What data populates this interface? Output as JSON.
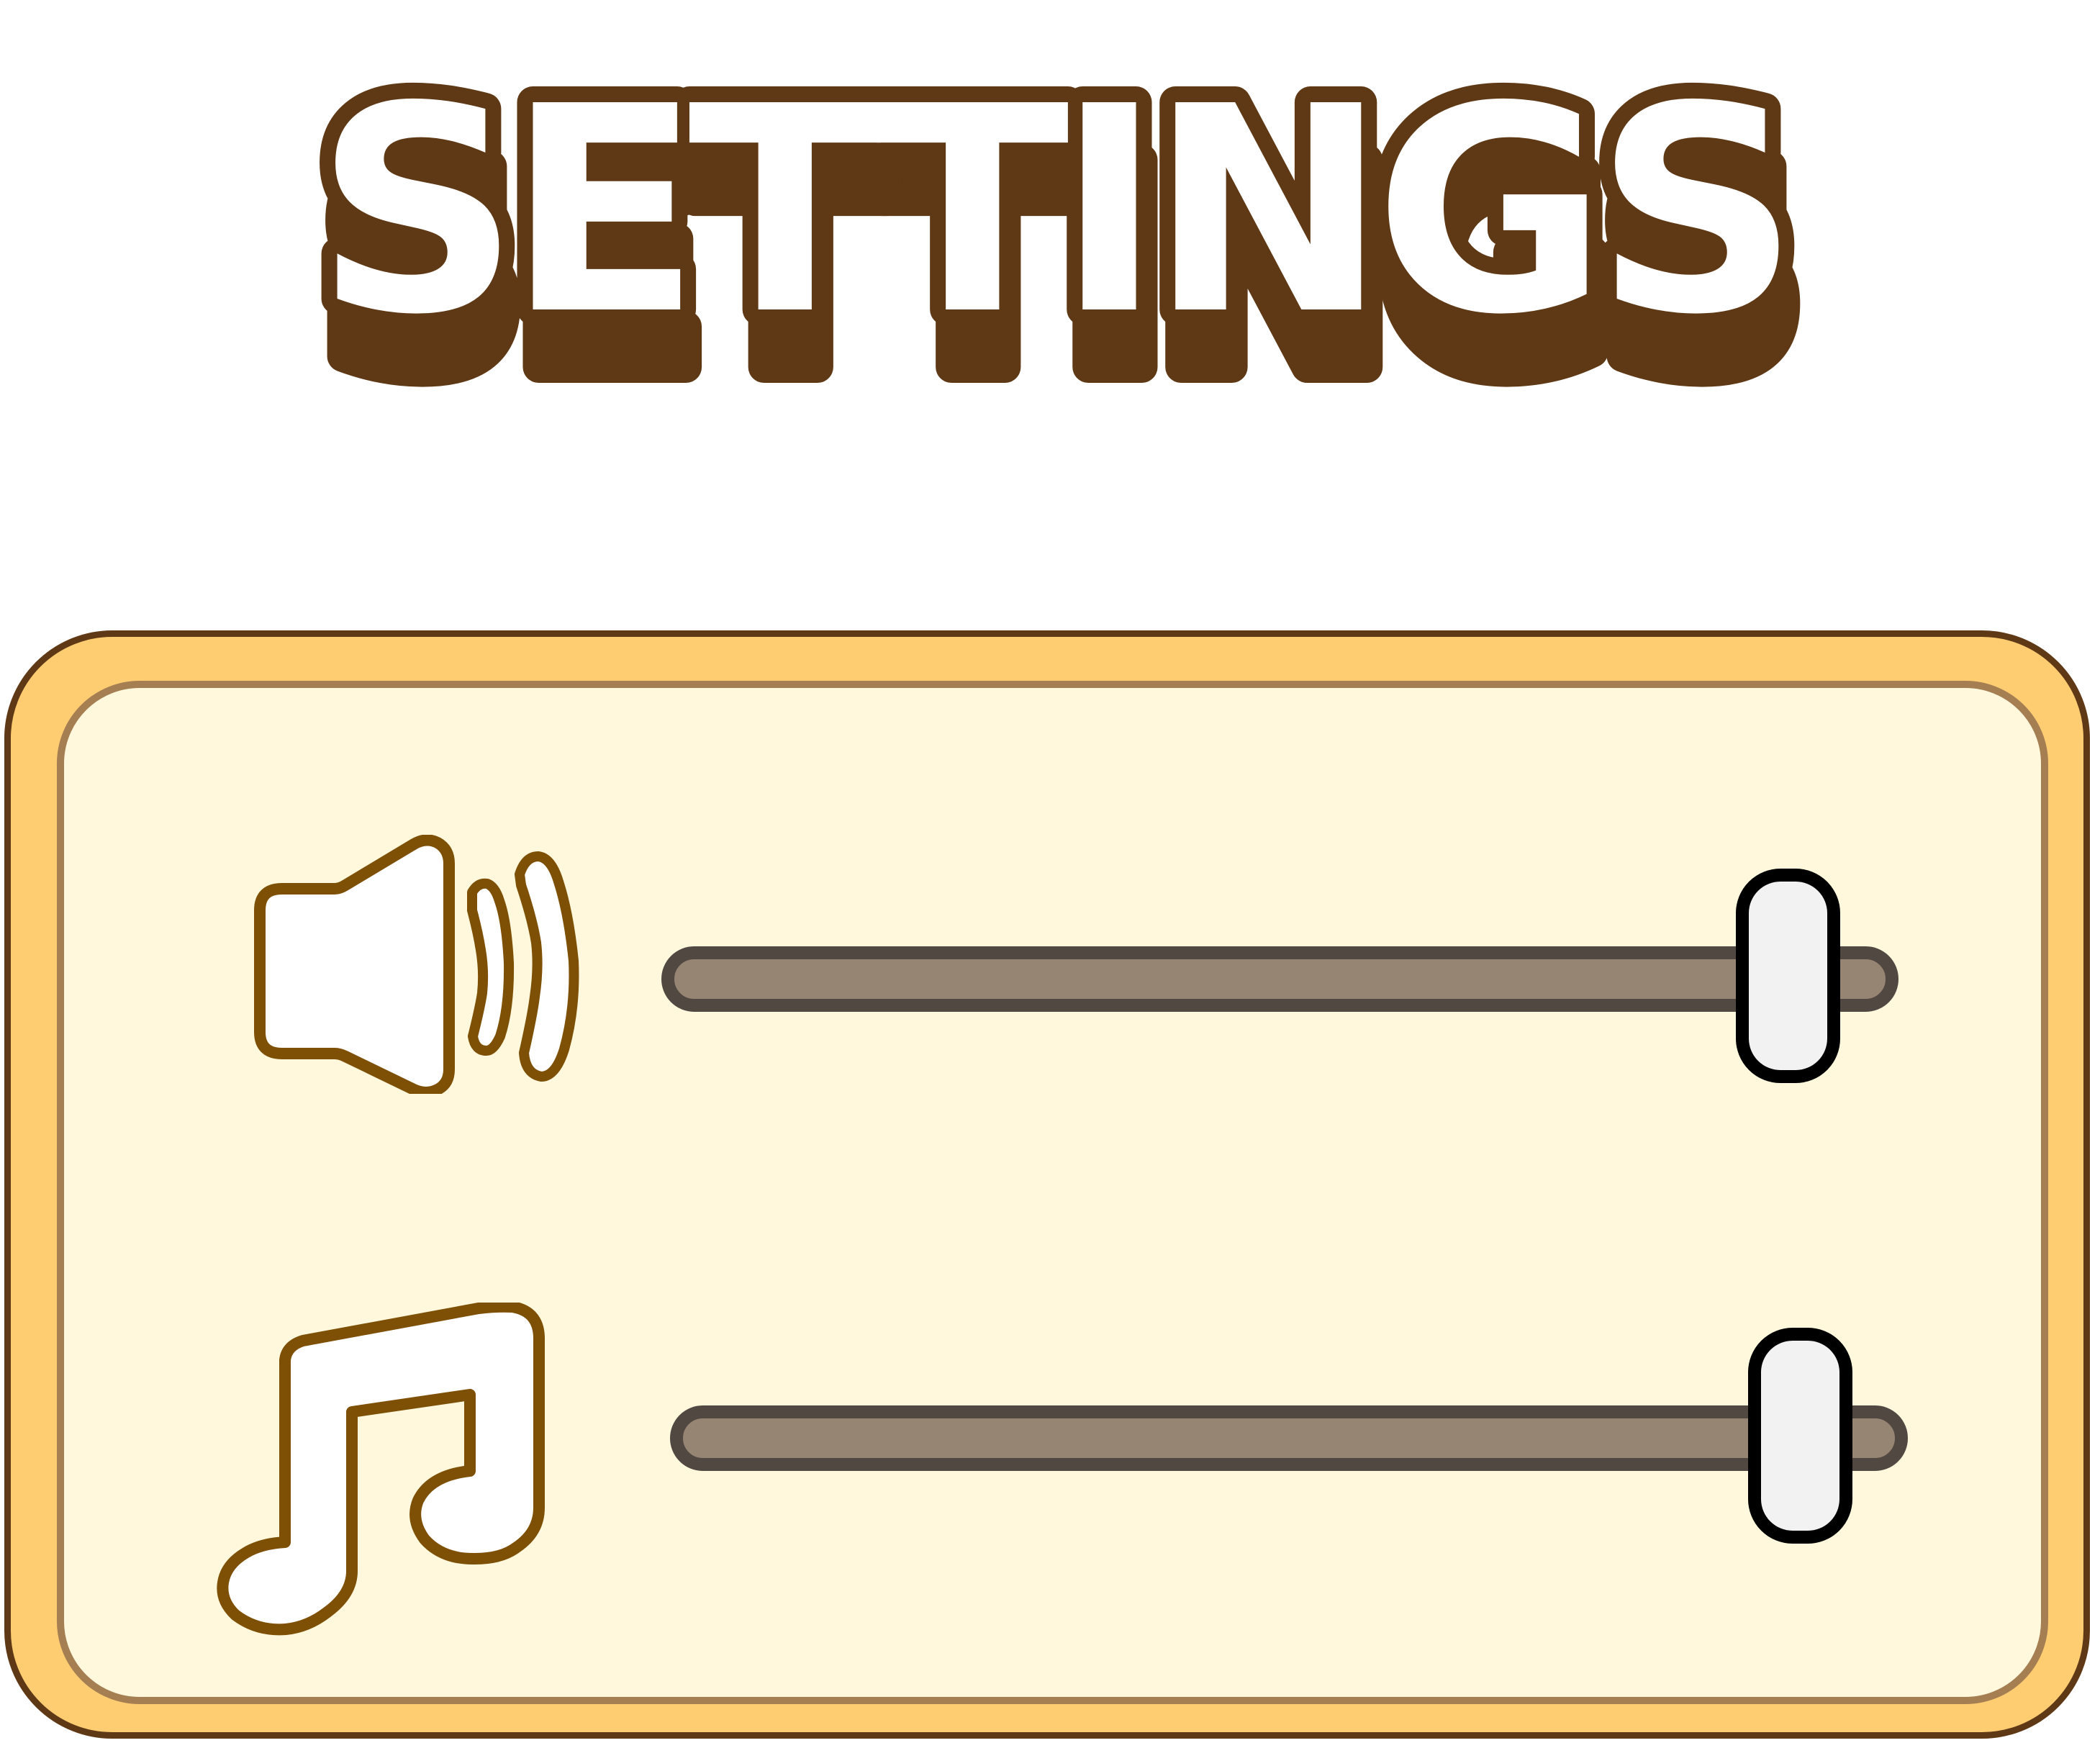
{
  "title": "SETTINGS",
  "colors": {
    "title_fill": "#ffffff",
    "title_outline": "#5f3915",
    "title_shadow": "#5f3915",
    "panel_outer": "#fecc71",
    "panel_outer_border": "#5f3915",
    "panel_inner": "#fff8dc",
    "panel_inner_border": "#a57e52",
    "icon_fill": "#ffffff",
    "icon_stroke": "#7e5006",
    "track_fill": "#978574",
    "track_border": "#514842",
    "thumb_fill": "#f2f2f2",
    "thumb_border": "#000000"
  },
  "settings": [
    {
      "name": "sound",
      "icon": "speaker-icon",
      "level": 0.93
    },
    {
      "name": "music",
      "icon": "music-note-icon",
      "level": 0.93
    }
  ]
}
